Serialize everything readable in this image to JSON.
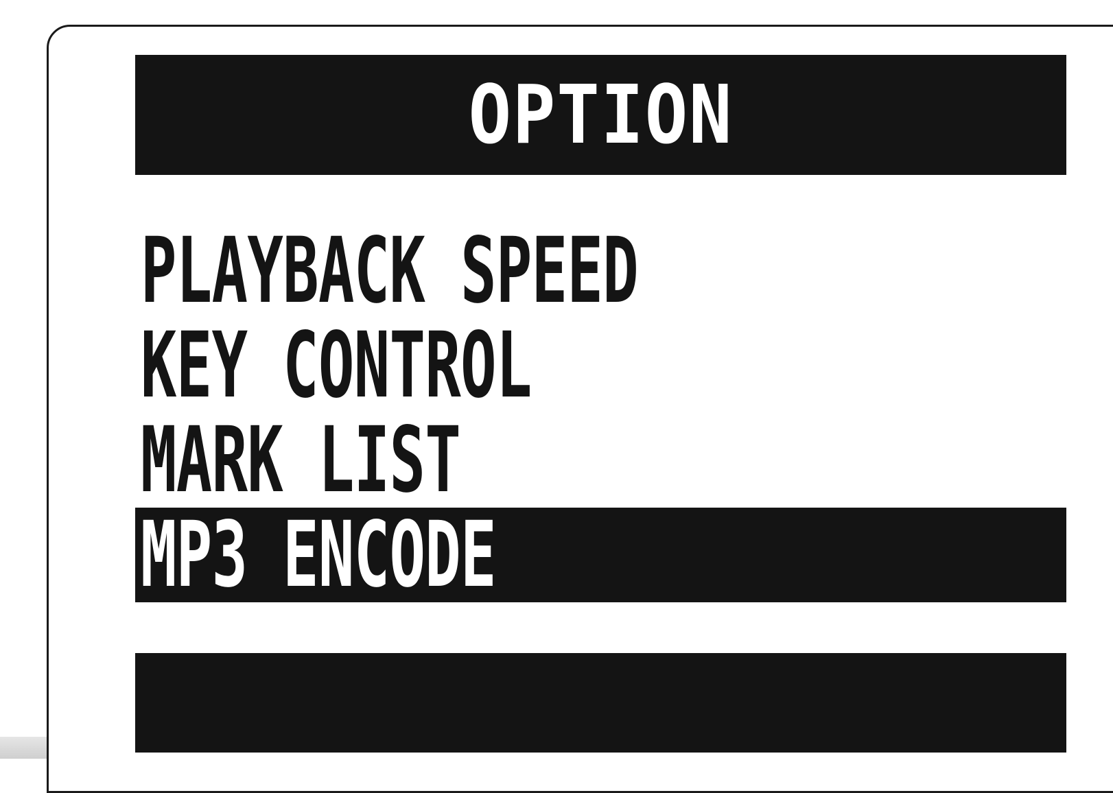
{
  "screen": {
    "title": "OPTION"
  },
  "menu": {
    "items": [
      {
        "label": "PLAYBACK SPEED",
        "selected": false
      },
      {
        "label": "KEY CONTROL",
        "selected": false
      },
      {
        "label": "MARK LIST",
        "selected": false
      },
      {
        "label": "MP3 ENCODE",
        "selected": true
      }
    ]
  },
  "colors": {
    "lcd_dark": "#141414",
    "lcd_light": "#ffffff"
  }
}
